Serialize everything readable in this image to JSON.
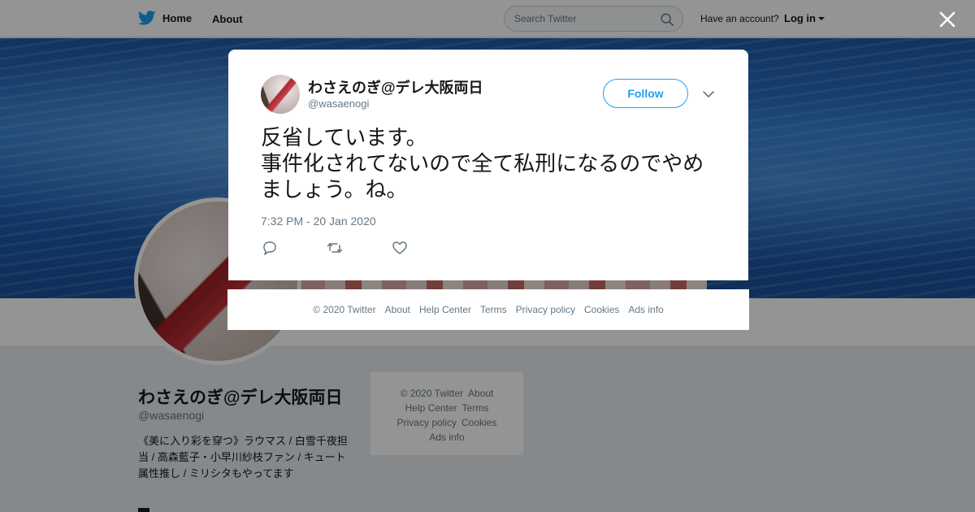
{
  "topbar": {
    "home_label": "Home",
    "about_label": "About",
    "search_placeholder": "Search Twitter",
    "account_prompt": "Have an account?",
    "login_label": "Log in"
  },
  "profile": {
    "name": "わさえのぎ@デレ大阪両日",
    "handle": "@wasaenogi",
    "bio": "《美に入り彩を穿つ》ラウマス / 白雪千夜担当 / 高森藍子・小早川紗枝ファン / キュート属性推し / ミリシタもやってます"
  },
  "side_footer": {
    "copyright": "© 2020 Twitter",
    "about": "About",
    "help": "Help Center",
    "terms": "Terms",
    "privacy": "Privacy policy",
    "cookies": "Cookies",
    "ads": "Ads info"
  },
  "tweet": {
    "name": "わさえのぎ@デレ大阪両日",
    "handle": "@wasaenogi",
    "follow_label": "Follow",
    "text": "反省しています。\n事件化されてないので全て私刑になるのでやめましょう。ね。",
    "timestamp": "7:32 PM - 20 Jan 2020"
  },
  "modal_footer": {
    "copyright": "© 2020 Twitter",
    "about": "About",
    "help": "Help Center",
    "terms": "Terms",
    "privacy": "Privacy policy",
    "cookies": "Cookies",
    "ads": "Ads info"
  },
  "colors": {
    "accent": "#1da1f2",
    "text_primary": "#14171a",
    "text_secondary": "#657786"
  },
  "icons": [
    "twitter-bird-icon",
    "home-icon",
    "search-icon",
    "caret-down-icon",
    "close-icon",
    "chevron-down-icon",
    "reply-icon",
    "retweet-icon",
    "like-icon"
  ]
}
